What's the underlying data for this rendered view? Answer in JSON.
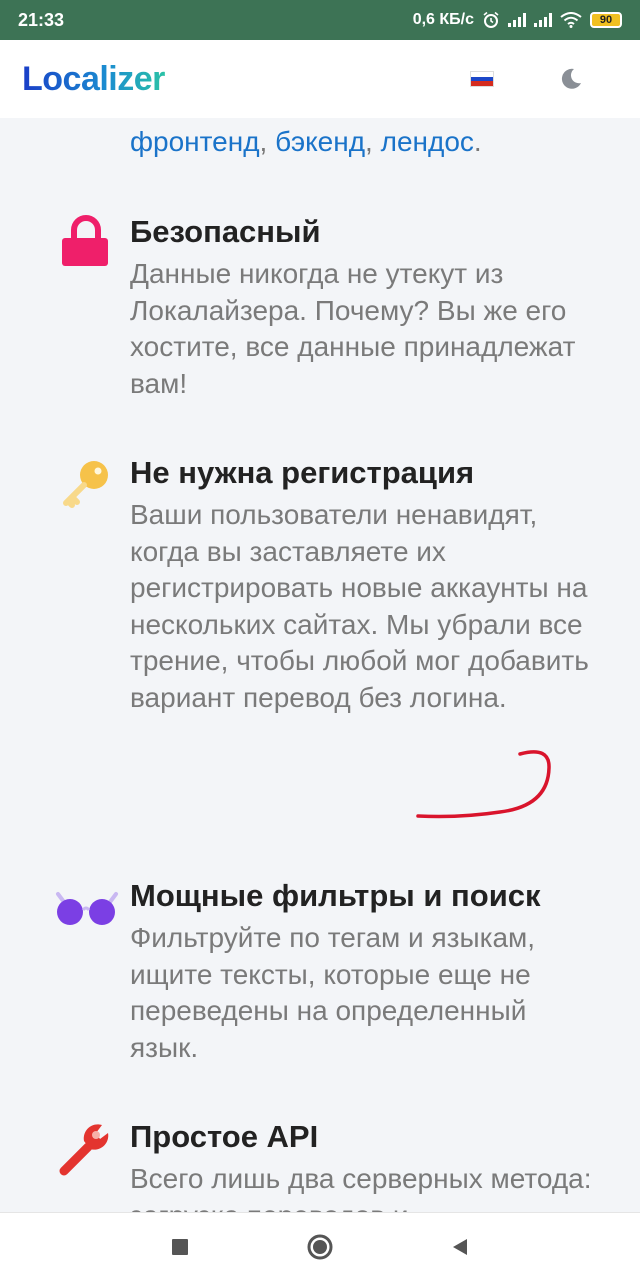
{
  "status_bar": {
    "time": "21:33",
    "speed": "0,6 КБ/с",
    "battery": "90"
  },
  "app_bar": {
    "logo": "Localizer",
    "flag_icon": "russia-flag-icon",
    "theme_icon": "moon-icon"
  },
  "top_cut_line": {
    "links": [
      "фронтенд",
      "бэкенд",
      "лендос"
    ],
    "sep": ", ",
    "end": "."
  },
  "features": [
    {
      "icon": "lock-icon",
      "title": "Безопасный",
      "description": "Данные никогда не утекут из Локалайзера. Почему? Вы же его хостите, все данные принадлежат вам!"
    },
    {
      "icon": "key-icon",
      "title": "Не нужна регистрация",
      "description": "Ваши пользователи ненавидят, когда вы заставляете их регистрировать новые аккаунты на нескольких сайтах. Мы убрали все трение, чтобы любой мог добавить вариант перевод без логина."
    },
    {
      "icon": "glasses-icon",
      "title": "Мощные фильтры и поиск",
      "description": "Фильтруйте по тегам и языкам, ищите тексты, которые еще не переведены на определенный язык."
    },
    {
      "icon": "wrench-icon",
      "title": "Простое API",
      "description": "Всего лишь два серверных метода: загрузка переводов и"
    }
  ],
  "colors": {
    "status_bar": "#3d7355",
    "link": "#1a73c9",
    "lock": "#ef1f6a",
    "key": "#f6c24a",
    "glasses": "#7b3fe4",
    "wrench": "#e3342f",
    "annotation": "#d9142c"
  },
  "nav_bar": {
    "buttons": [
      "stop-square-icon",
      "home-circle-icon",
      "back-triangle-icon"
    ]
  }
}
